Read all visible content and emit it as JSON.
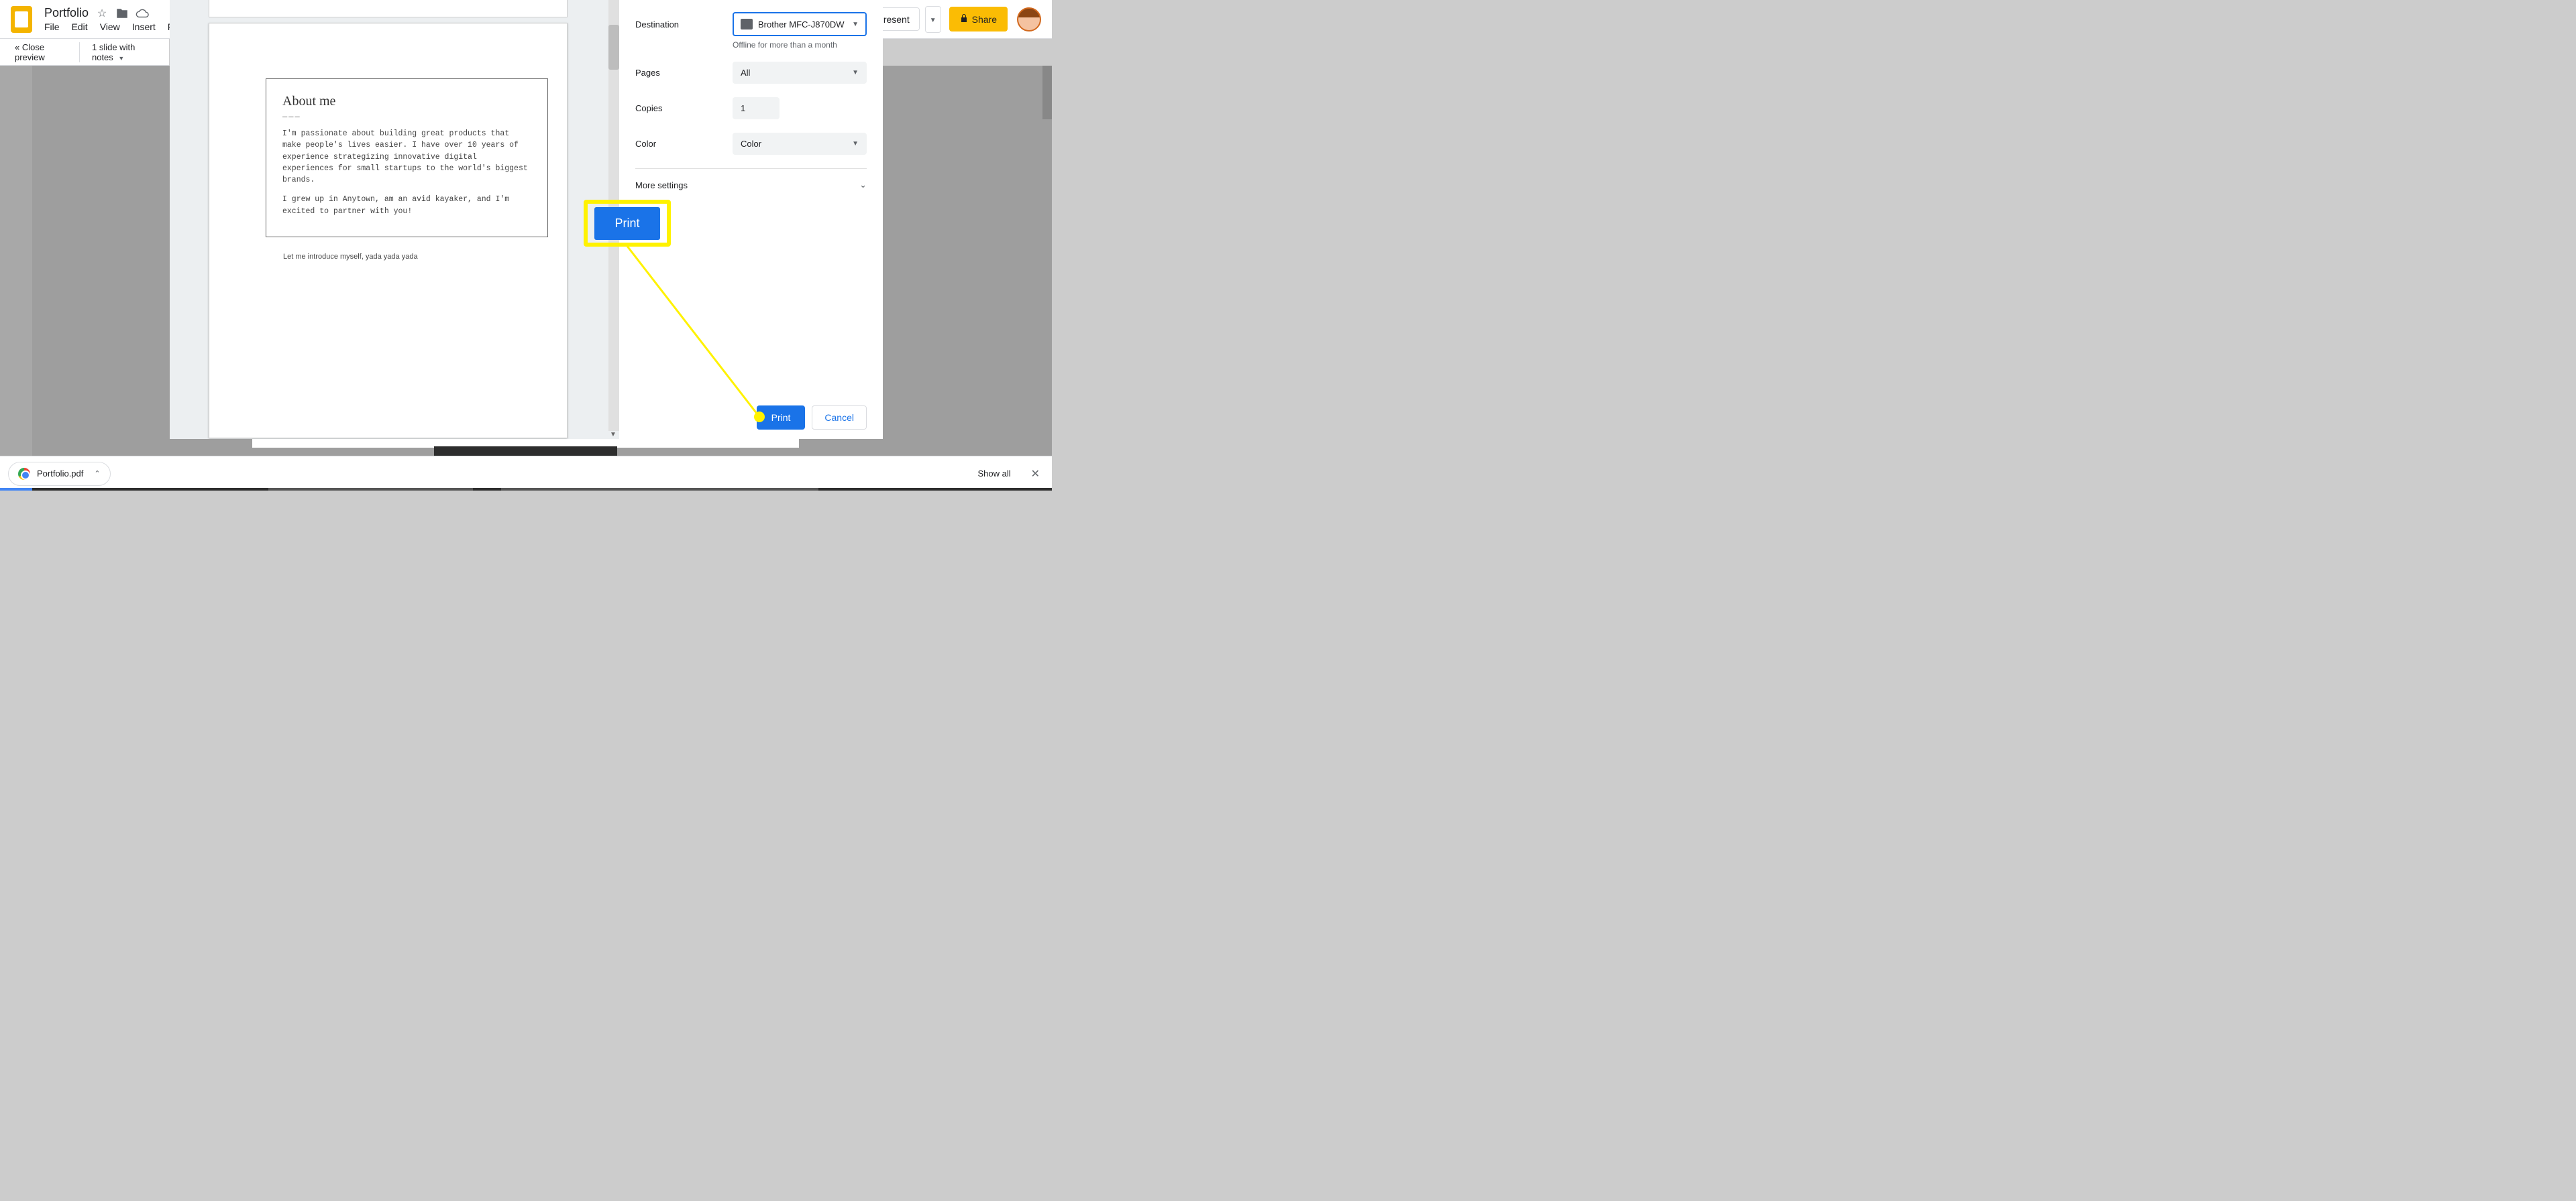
{
  "app": {
    "doc_title": "Portfolio",
    "menus": [
      "File",
      "Edit",
      "View",
      "Insert",
      "F"
    ],
    "present": "Present",
    "share": "Share"
  },
  "subbar": {
    "close": "« Close preview",
    "slide_info": "1 slide with notes"
  },
  "preview": {
    "slide_title": "About me",
    "divider": "———",
    "body1": "I'm passionate about building great products that make people's lives easier. I have over 10 years of experience strategizing innovative digital experiences for small startups to the world's biggest brands.",
    "body2": "I grew up in Anytown, am an avid kayaker, and I'm excited to partner with you!",
    "notes": "Let me introduce myself, yada yada yada"
  },
  "print": {
    "destination_label": "Destination",
    "destination_value": "Brother MFC-J870DW",
    "offline": "Offline for more than a month",
    "pages_label": "Pages",
    "pages_value": "All",
    "copies_label": "Copies",
    "copies_value": "1",
    "color_label": "Color",
    "color_value": "Color",
    "more": "More settings",
    "print_btn": "Print",
    "cancel_btn": "Cancel"
  },
  "highlight": {
    "label": "Print"
  },
  "download": {
    "filename": "Portfolio.pdf",
    "show_all": "Show all"
  }
}
